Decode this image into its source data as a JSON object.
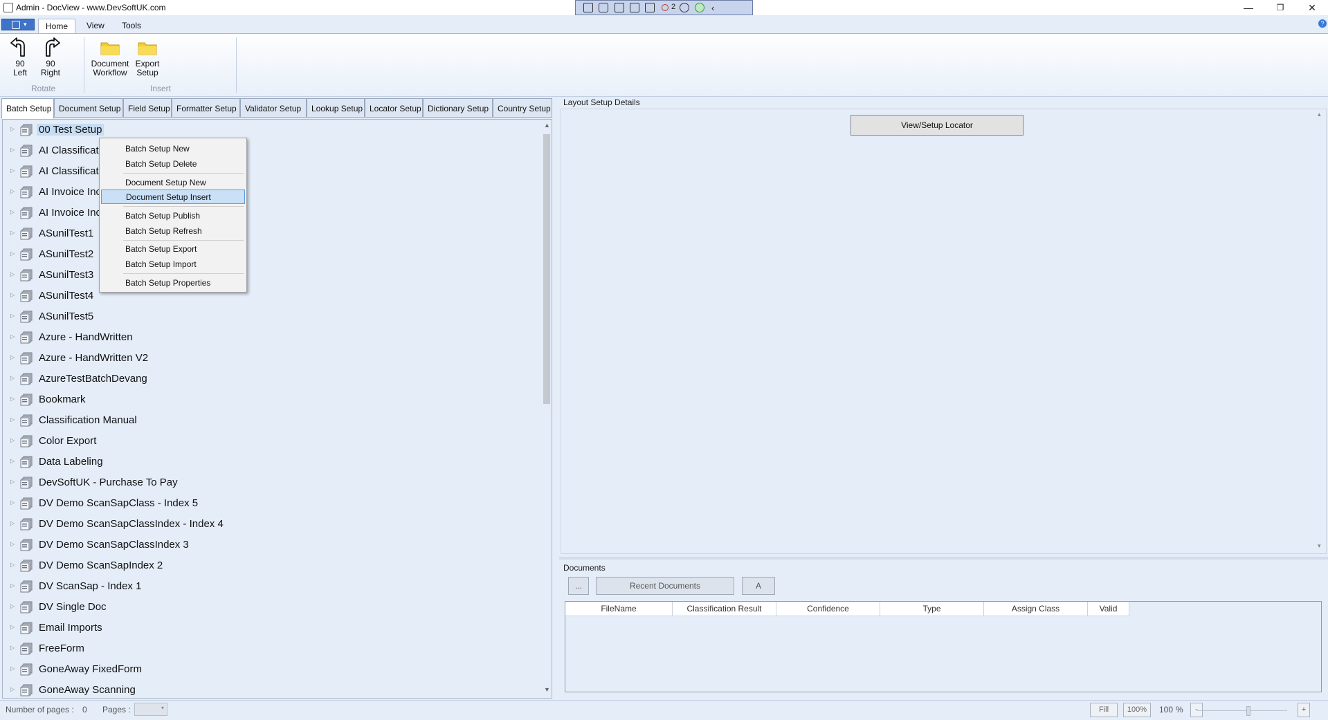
{
  "window": {
    "title": "Admin - DocView - www.DevSoftUK.com",
    "controls": {
      "minimize": "—",
      "restore": "❐",
      "close": "✕"
    }
  },
  "capture_toolbar": {
    "counter": "2"
  },
  "ribbon": {
    "tabs": [
      "Home",
      "View",
      "Tools"
    ],
    "active_tab": "Home",
    "buttons": {
      "rotate_left": {
        "line1": "90",
        "line2": "Left"
      },
      "rotate_right": {
        "line1": "90",
        "line2": "Right"
      },
      "document_workflow": {
        "line1": "Document",
        "line2": "Workflow"
      },
      "export_setup": {
        "line1": "Export",
        "line2": "Setup"
      }
    },
    "groups": {
      "rotate": "Rotate",
      "insert": "Insert"
    }
  },
  "setup_tabs": [
    "Batch Setup",
    "Document Setup",
    "Field Setup",
    "Formatter Setup",
    "Validator Setup",
    "Lookup Setup",
    "Locator Setup",
    "Dictionary Setup",
    "Country Setup"
  ],
  "tree": {
    "items": [
      "00 Test Setup",
      "AI Classificati",
      "AI Classificati",
      "AI Invoice Inc",
      "AI Invoice Inc",
      "ASunilTest1",
      "ASunilTest2",
      "ASunilTest3",
      "ASunilTest4",
      "ASunilTest5",
      "Azure - HandWritten",
      "Azure - HandWritten V2",
      "AzureTestBatchDevang",
      "Bookmark",
      "Classification Manual",
      "Color Export",
      "Data Labeling",
      "DevSoftUK - Purchase To Pay",
      "DV Demo ScanSapClass - Index 5",
      "DV Demo ScanSapClassIndex - Index 4",
      "DV Demo ScanSapClassIndex 3",
      "DV Demo ScanSapIndex 2",
      "DV ScanSap - Index 1",
      "DV Single Doc",
      "Email Imports",
      "FreeForm",
      "GoneAway FixedForm",
      "GoneAway Scanning"
    ]
  },
  "context_menu": {
    "items": [
      "Batch Setup New",
      "Batch Setup Delete",
      "Document Setup New",
      "Document Setup Insert",
      "Batch Setup Publish",
      "Batch Setup Refresh",
      "Batch Setup Export",
      "Batch Setup Import",
      "Batch Setup Properties"
    ],
    "highlighted": "Document Setup Insert"
  },
  "layout_details": {
    "label": "Layout Setup Details",
    "locator_button": "View/Setup Locator"
  },
  "documents": {
    "label": "Documents",
    "browse_button": "...",
    "recent_button": "Recent Documents",
    "a_button": "A",
    "columns": [
      "FileName",
      "Classification Result",
      "Confidence",
      "Type",
      "Assign Class",
      "Valid"
    ]
  },
  "status": {
    "pages_label": "Number of pages :",
    "pages_value": "0",
    "pages_combo_label": "Pages :",
    "fill_button": "Fill",
    "zoom_100_button": "100%",
    "zoom_value": "100",
    "zoom_unit": "%",
    "zoom_out": "-",
    "zoom_in": "+"
  },
  "colors": {
    "background": "#e4edf8",
    "selection": "#c5dcf3",
    "menu_highlight": "#c9e0f7",
    "app_menu": "#3e73c8"
  }
}
